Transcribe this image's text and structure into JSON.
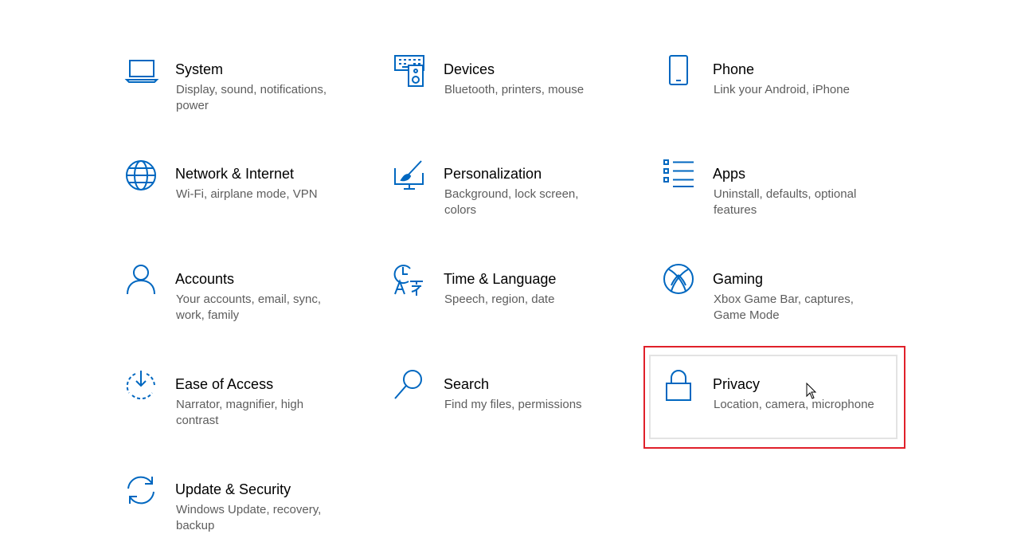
{
  "accent_color": "#0067c0",
  "highlight_color": "#e0202a",
  "tiles": [
    {
      "title": "System",
      "desc": "Display, sound, notifications, power",
      "icon": "laptop-icon"
    },
    {
      "title": "Devices",
      "desc": "Bluetooth, printers, mouse",
      "icon": "devices-icon"
    },
    {
      "title": "Phone",
      "desc": "Link your Android, iPhone",
      "icon": "phone-icon"
    },
    {
      "title": "Network & Internet",
      "desc": "Wi-Fi, airplane mode, VPN",
      "icon": "globe-icon"
    },
    {
      "title": "Personalization",
      "desc": "Background, lock screen, colors",
      "icon": "paint-brush-icon"
    },
    {
      "title": "Apps",
      "desc": "Uninstall, defaults, optional features",
      "icon": "apps-list-icon"
    },
    {
      "title": "Accounts",
      "desc": "Your accounts, email, sync, work, family",
      "icon": "person-icon"
    },
    {
      "title": "Time & Language",
      "desc": "Speech, region, date",
      "icon": "time-language-icon"
    },
    {
      "title": "Gaming",
      "desc": "Xbox Game Bar, captures, Game Mode",
      "icon": "xbox-icon"
    },
    {
      "title": "Ease of Access",
      "desc": "Narrator, magnifier, high contrast",
      "icon": "ease-of-access-icon"
    },
    {
      "title": "Search",
      "desc": "Find my files, permissions",
      "icon": "search-icon"
    },
    {
      "title": "Privacy",
      "desc": "Location, camera, microphone",
      "icon": "lock-icon"
    },
    {
      "title": "Update & Security",
      "desc": "Windows Update, recovery, backup",
      "icon": "sync-icon"
    }
  ]
}
